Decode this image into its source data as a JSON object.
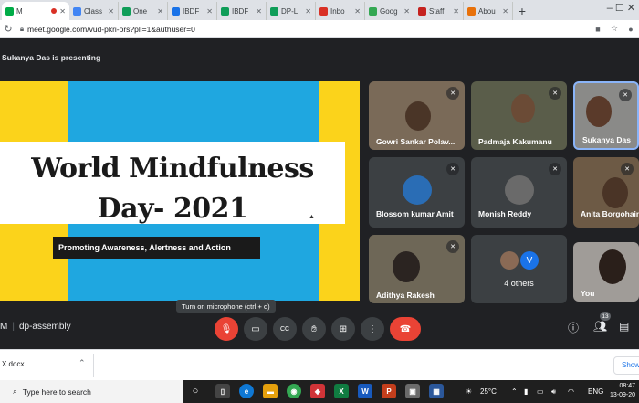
{
  "browser": {
    "tabs": [
      {
        "label": "M",
        "favicon_color": "#00ac47",
        "recording": true,
        "active": true
      },
      {
        "label": "Class",
        "favicon_color": "#4285f4"
      },
      {
        "label": "One",
        "favicon_color": "#0f9d58"
      },
      {
        "label": "IBDF",
        "favicon_color": "#1a73e8"
      },
      {
        "label": "IBDF",
        "favicon_color": "#0f9d58"
      },
      {
        "label": "DP-L",
        "favicon_color": "#0f9d58"
      },
      {
        "label": "Inbo",
        "favicon_color": "#d93025"
      },
      {
        "label": "Goog",
        "favicon_color": "#34a853"
      },
      {
        "label": "Staff",
        "favicon_color": "#c5221f"
      },
      {
        "label": "Abou",
        "favicon_color": "#e8710a"
      }
    ],
    "new_tab": "+",
    "url": "meet.google.com/vud-pkri-ors?pli=1&authuser=0"
  },
  "meet": {
    "presenting_text": "Sukanya Das is presenting",
    "slide": {
      "title_line1": "World Mindfulness",
      "title_line2": "Day- 2021",
      "subtitle": "Promoting Awareness, Alertness and Action"
    },
    "participants": [
      {
        "name": "Gowri Sankar Polav...",
        "muted": true
      },
      {
        "name": "Padmaja Kakumanu",
        "muted": true
      },
      {
        "name": "Sukanya Das",
        "muted": true,
        "presenting": true
      },
      {
        "name": "Blossom kumar Amit",
        "muted": true
      },
      {
        "name": "Monish Reddy",
        "muted": true
      },
      {
        "name": "Anita Borgohain",
        "muted": true
      },
      {
        "name": "Adithya Rakesh",
        "muted": true
      },
      {
        "name": "4 others",
        "avatar_letter": "V"
      },
      {
        "name": "You",
        "muted": false
      }
    ],
    "tooltip": "Turn on microphone (ctrl + d)",
    "meeting_code_prefix": "M",
    "meeting_name": "dp-assembly",
    "participant_count": "13"
  },
  "downloads": {
    "file": "X.docx",
    "show_all": "Show"
  },
  "taskbar": {
    "search_placeholder": "Type here to search",
    "weather": "25°C",
    "language": "ENG",
    "time": "08:47",
    "date": "13-09-20"
  }
}
